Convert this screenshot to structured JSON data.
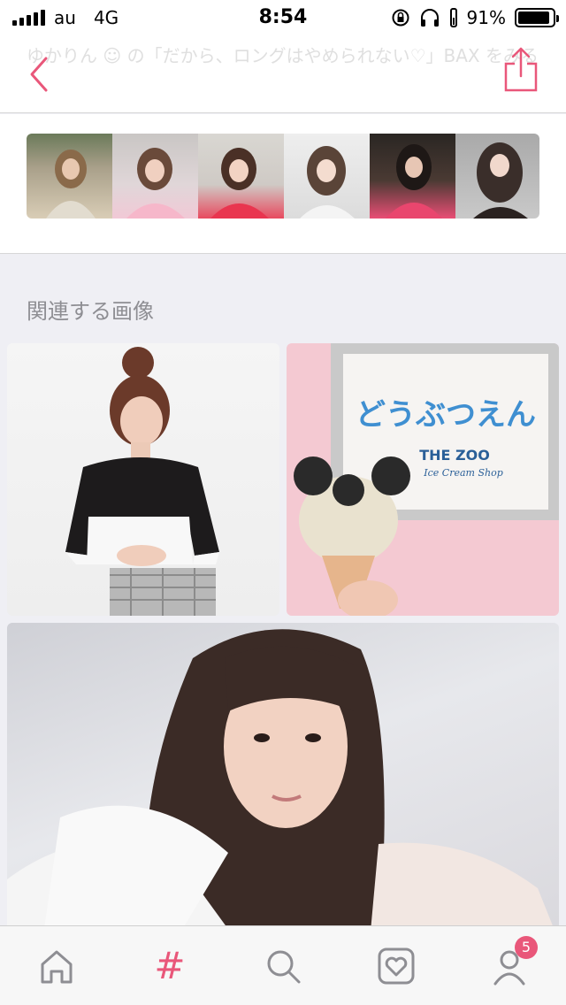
{
  "status_bar": {
    "carrier": "au",
    "network": "4G",
    "time": "8:54",
    "battery_percent": "91%",
    "battery_level": 0.91
  },
  "header": {
    "title": "ゆかりん ☺ の「だから、ロングはやめられない♡」BAX をみる",
    "back_icon": "chevron-left-icon",
    "share_icon": "share-icon"
  },
  "related": {
    "label": "関連する画像"
  },
  "tab_bar": {
    "tabs": [
      {
        "name": "home",
        "icon": "home-icon"
      },
      {
        "name": "hashtag",
        "icon": "hashtag-icon",
        "glyph": "#",
        "active": true
      },
      {
        "name": "search",
        "icon": "search-icon"
      },
      {
        "name": "favorites",
        "icon": "heart-icon"
      },
      {
        "name": "profile",
        "icon": "user-icon",
        "badge": "5"
      }
    ]
  },
  "colors": {
    "accent": "#e9577a",
    "icon_gray": "#8e8e93"
  },
  "images": {
    "photo_b_text_main": "どうぶつえん",
    "photo_b_text_sub": "THE ZOO",
    "photo_b_text_sub2": "Ice Cream Shop"
  }
}
